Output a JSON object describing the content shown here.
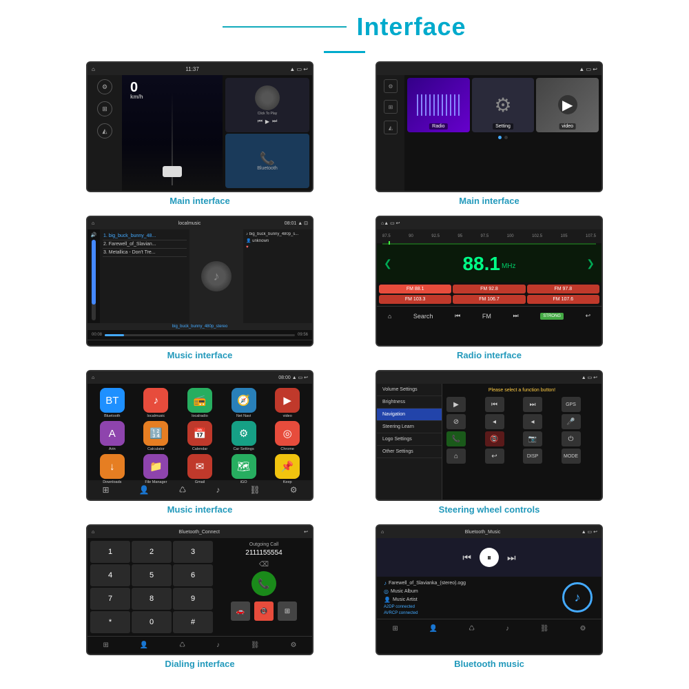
{
  "header": {
    "title": "Interface",
    "line_present": true
  },
  "cells": [
    {
      "caption": "Main interface",
      "id": "s1"
    },
    {
      "caption": "Main interface",
      "id": "s2"
    },
    {
      "caption": "Music interface",
      "id": "s3"
    },
    {
      "caption": "Radio interface",
      "id": "s4"
    },
    {
      "caption": "Music interface",
      "id": "s5"
    },
    {
      "caption": "Steering wheel controls",
      "id": "s6"
    },
    {
      "caption": "Dialing interface",
      "id": "s7"
    },
    {
      "caption": "Bluetooth music",
      "id": "s8"
    }
  ],
  "screen1": {
    "speed": "0",
    "unit": "km/h",
    "status_bar": "11:37",
    "click_to_play": "Click To Play",
    "bluetooth": "Bluetooth"
  },
  "screen2": {
    "tiles": [
      "Radio",
      "Setting",
      "video"
    ]
  },
  "screen3": {
    "playlist": [
      "1. big_buck_bunny_48...",
      "2. Farewell_of_Slavian...",
      "3. Metallica - Don't Tre..."
    ],
    "track_name": "big_buck_bunny_480p_stereo",
    "meta_file": "big_buck_bunny_480p_s...",
    "meta_artist": "unknown",
    "time_start": "00:08",
    "time_end": "09:56"
  },
  "screen4": {
    "freq_labels": [
      "87.5",
      "90",
      "92.5",
      "95",
      "97.5",
      "100",
      "102.5",
      "105",
      "107.5"
    ],
    "main_freq": "88.1",
    "presets": [
      "FM 88.1",
      "FM 92.8",
      "FM 97.8",
      "FM 103.3",
      "FM 106.7",
      "FM 107.6"
    ]
  },
  "screen5": {
    "apps": [
      {
        "name": "Bluetooth",
        "color": "#1e90ff",
        "icon": "🔵"
      },
      {
        "name": "localmusic",
        "color": "#e74c3c",
        "icon": "♪"
      },
      {
        "name": "localradio",
        "color": "#27ae60",
        "icon": "📻"
      },
      {
        "name": "Net Navi",
        "color": "#2980b9",
        "icon": "🧭"
      },
      {
        "name": "video",
        "color": "#c0392b",
        "icon": "▶"
      },
      {
        "name": "Arin",
        "color": "#8e44ad",
        "icon": "A"
      },
      {
        "name": "Calculator",
        "color": "#e67e22",
        "icon": "🔢"
      },
      {
        "name": "Calendar",
        "color": "#c0392b",
        "icon": "📅"
      },
      {
        "name": "Car Settings",
        "color": "#16a085",
        "icon": "⚙"
      },
      {
        "name": "Chrome",
        "color": "#e74c3c",
        "icon": "◎"
      },
      {
        "name": "Downloads",
        "color": "#e67e22",
        "icon": "↓"
      },
      {
        "name": "File Manager",
        "color": "#8e44ad",
        "icon": "📁"
      },
      {
        "name": "Gmail",
        "color": "#c0392b",
        "icon": "✉"
      },
      {
        "name": "iGO",
        "color": "#27ae60",
        "icon": "🗺"
      },
      {
        "name": "Keep",
        "color": "#f1c40f",
        "icon": "📌"
      }
    ]
  },
  "screen6": {
    "menu_items": [
      "Volume Settings",
      "Brightness",
      "Navigation",
      "Steering Learn",
      "Logo Settings",
      "Other Settings"
    ],
    "active_item": "Navigation",
    "notice": "Please select a function button!",
    "buttons": [
      "▶",
      "⏮",
      "⏭",
      "GPS",
      "⊘",
      "◀",
      "◀",
      "🎙",
      "📞",
      "☎",
      "📷",
      "⏻",
      "⌂",
      "↩",
      "DISP",
      "MODE"
    ]
  },
  "screen7": {
    "title": "Bluetooth_Connect",
    "outgoing": "Outgoing Call",
    "number": "2111155554",
    "keys": [
      "1",
      "2",
      "3",
      "4",
      "5",
      "6",
      "7",
      "8",
      "9",
      "*",
      "0",
      "#"
    ]
  },
  "screen8": {
    "title": "Bluetooth_Music",
    "track": "Farewell_of_Slavianka_(stereo).ogg",
    "album": "Music Album",
    "artist": "Music Artist",
    "status1": "A2DP connected",
    "status2": "AVRCP connected"
  }
}
